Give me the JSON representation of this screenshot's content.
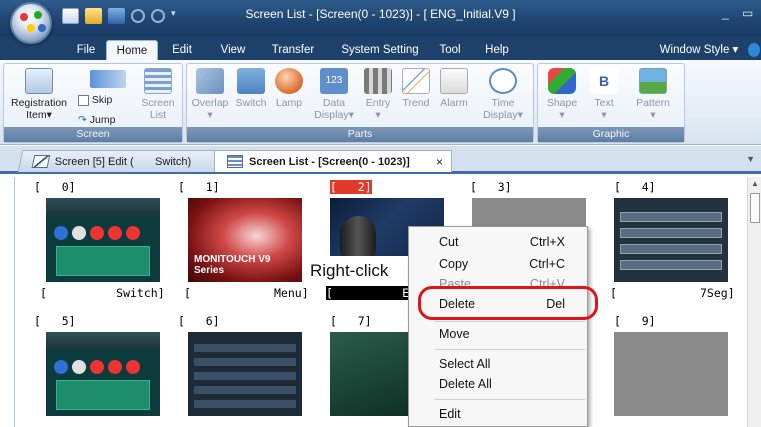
{
  "window": {
    "title": "Screen List - [Screen(0 - 1023)] - [ ENG_Initial.V9 ]",
    "minimize": "_",
    "maximize": "▭"
  },
  "ribbon_tabs": [
    "File",
    "Home",
    "Edit",
    "View",
    "Transfer",
    "System Setting",
    "Tool",
    "Help"
  ],
  "window_style": "Window Style",
  "ribbon": {
    "screen_group": {
      "label": "Screen",
      "registration": "Registration",
      "registration_sub": "Item",
      "skip": "Skip",
      "jump": "Jump",
      "screen_list_1": "Screen",
      "screen_list_2": "List"
    },
    "parts_group": {
      "label": "Parts",
      "items": [
        "Overlap",
        "Switch",
        "Lamp",
        "Data",
        "Entry",
        "Trend",
        "Alarm",
        "Time"
      ],
      "data_sub": "Display",
      "time_sub": "Display",
      "data_icon": "123"
    },
    "graphic_group": {
      "label": "Graphic",
      "items": [
        "Shape",
        "Text",
        "Pattern"
      ]
    }
  },
  "doc_tabs": {
    "tab1": "Screen [5] Edit (       Switch)",
    "tab2": "Screen List - [Screen(0 - 1023)]",
    "close": "×"
  },
  "cells": [
    {
      "num": "[   0]",
      "name": "[          Switch]"
    },
    {
      "num": "[   1]",
      "name": "[            Menu]"
    },
    {
      "num": "[   2]",
      "name": "[          En"
    },
    {
      "num": "[   3]",
      "name": ""
    },
    {
      "num": "[   4]",
      "name": "[            7Seg]"
    },
    {
      "num": "[   5]",
      "name": ""
    },
    {
      "num": "[   6]",
      "name": ""
    },
    {
      "num": "[   7]",
      "name": ""
    },
    {
      "num": "[   9]",
      "name": ""
    }
  ],
  "thumb_text": {
    "menu_logo": "MONITOUCH V9 Series"
  },
  "annotation": "Right-click",
  "context_menu": [
    {
      "label": "Cut",
      "shortcut": "Ctrl+X",
      "enabled": true
    },
    {
      "label": "Copy",
      "shortcut": "Ctrl+C",
      "enabled": true
    },
    {
      "label": "Paste",
      "shortcut": "Ctrl+V",
      "enabled": false
    },
    {
      "label": "Delete",
      "shortcut": "Del",
      "enabled": true,
      "highlighted": true
    },
    {
      "label": "Move",
      "shortcut": "",
      "enabled": true
    },
    {
      "label": "Select All",
      "shortcut": "",
      "enabled": true
    },
    {
      "label": "Delete All",
      "shortcut": "",
      "enabled": true
    },
    {
      "label": "Edit",
      "shortcut": "",
      "enabled": true
    }
  ],
  "colors": {
    "accent": "#1d416b",
    "highlight": "#e0131a",
    "selected_cell": "#e03a2b"
  }
}
